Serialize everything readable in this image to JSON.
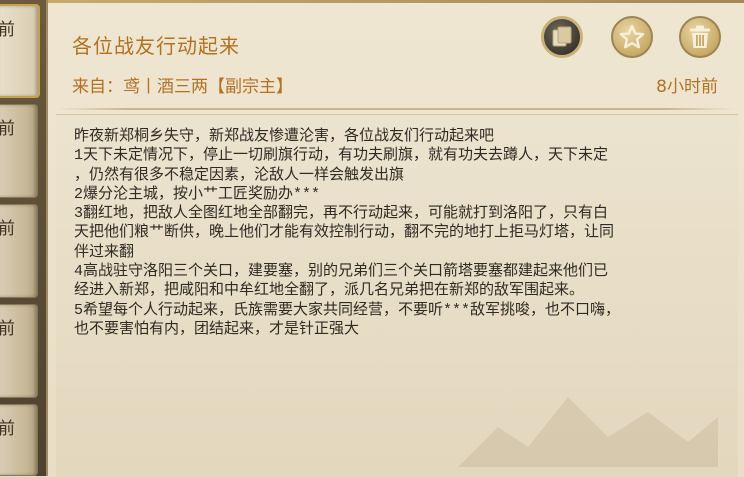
{
  "side_tabs": [
    {
      "label": "前",
      "active": true
    },
    {
      "label": "前",
      "active": false
    },
    {
      "label": "前",
      "active": false
    },
    {
      "label": "前",
      "active": false
    },
    {
      "label": "前",
      "active": false
    }
  ],
  "mail": {
    "title": "各位战友行动起来",
    "from": "来自：鸢丨酒三两【副宗主】",
    "time": "8小时前",
    "body": "昨夜新郑桐乡失守，新郑战友惨遭沦害，各位战友们行动起来吧\n1天下未定情况下，停止一切刷旗行动，有功夫刷旗，就有功夫去蹲人，天下未定\n，仍然有很多不稳定因素，沦敌人一样会触发出旗\n2爆分沦主城，按小艹工匠奖励办***\n3翻红地，把敌人全图红地全部翻完，再不行动起来，可能就打到洛阳了，只有白\n天把他们粮艹断供，晚上他们才能有效控制行动，翻不完的地打上拒马灯塔，让同\n伴过来翻\n4高战驻守洛阳三个关口，建要塞，别的兄弟们三个关口箭塔要塞都建起来他们已\n经进入新郑，把咸阳和中牟红地全翻了，派几名兄弟把在新郑的敌军围起来。\n5希望每个人行动起来，氏族需要大家共同经营，不要听***敌军挑唆，也不口嗨，\n也不要害怕有内，团结起来，才是针正强大"
  },
  "actions": {
    "copy_icon": "copy-icon",
    "favorite_icon": "star-icon",
    "delete_icon": "trash-icon"
  },
  "colors": {
    "accent_text": "#b17222",
    "body_text": "#2f2a22",
    "panel_bg": "#ece3cf",
    "tab_border_active": "#c7a24c"
  }
}
